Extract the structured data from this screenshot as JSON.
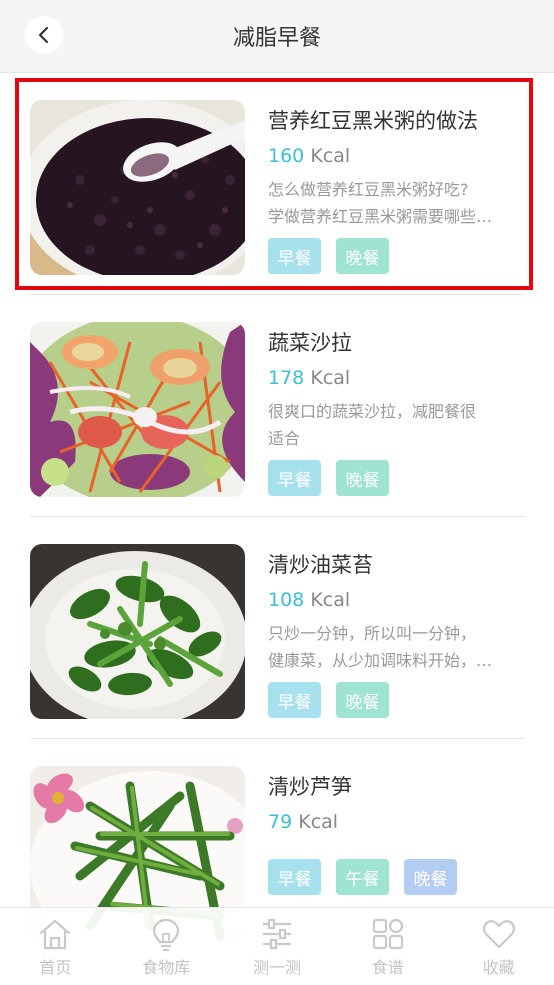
{
  "header": {
    "title": "减脂早餐"
  },
  "recipes": [
    {
      "title": "营养红豆黑米粥的做法",
      "kcal_value": "160",
      "kcal_unit": "Kcal",
      "desc_line1": "怎么做营养红豆黑米粥好吃?",
      "desc_line2": "学做营养红豆黑米粥需要哪些…",
      "tags": [
        "早餐",
        "晚餐"
      ],
      "image": "black-rice-porridge"
    },
    {
      "title": "蔬菜沙拉",
      "kcal_value": "178",
      "kcal_unit": "Kcal",
      "desc_line1": "很爽口的蔬菜沙拉，减肥餐很",
      "desc_line2": "适合",
      "tags": [
        "早餐",
        "晚餐"
      ],
      "image": "vegetable-salad"
    },
    {
      "title": "清炒油菜苔",
      "kcal_value": "108",
      "kcal_unit": "Kcal",
      "desc_line1": "只炒一分钟，所以叫一分钟，",
      "desc_line2": "健康菜，从少加调味料开始，…",
      "tags": [
        "早餐",
        "晚餐"
      ],
      "image": "stir-fried-greens"
    },
    {
      "title": "清炒芦笋",
      "kcal_value": "79",
      "kcal_unit": "Kcal",
      "tags": [
        "早餐",
        "午餐",
        "晚餐"
      ],
      "image": "stir-fried-asparagus"
    }
  ],
  "tabbar": {
    "items": [
      {
        "label": "首页",
        "icon": "home-icon"
      },
      {
        "label": "食物库",
        "icon": "lightbulb-icon"
      },
      {
        "label": "测一测",
        "icon": "sliders-icon"
      },
      {
        "label": "食谱",
        "icon": "grid-icon"
      },
      {
        "label": "收藏",
        "icon": "heart-icon"
      }
    ]
  },
  "colors": {
    "accent": "#3bbfd6",
    "highlight_border": "#e30613",
    "tag_breakfast": "#a8e1ee",
    "tag_lunch": "#9fe3d3",
    "tag_dinner_blue": "#b3cdf2"
  }
}
